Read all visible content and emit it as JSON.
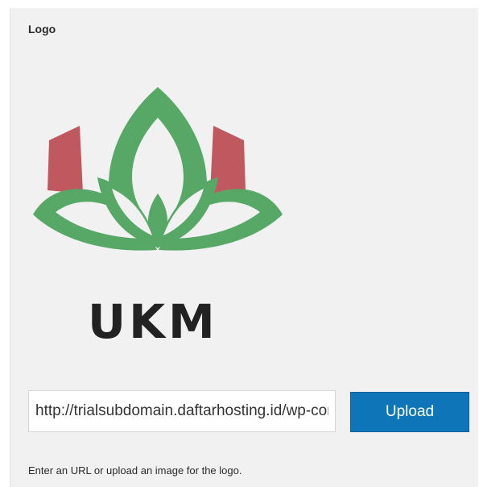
{
  "logo_section": {
    "title": "Logo",
    "logo_text": "UKM",
    "colors": {
      "leaf_green": "#57a866",
      "petal_red": "#c05860",
      "logo_text": "#222222",
      "button_blue": "#0e76b8"
    },
    "url_value": "http://trialsubdomain.daftarhosting.id/wp-content/uploads/ukm-logo.png",
    "upload_label": "Upload",
    "help_text": "Enter an URL or upload an image for the logo."
  }
}
